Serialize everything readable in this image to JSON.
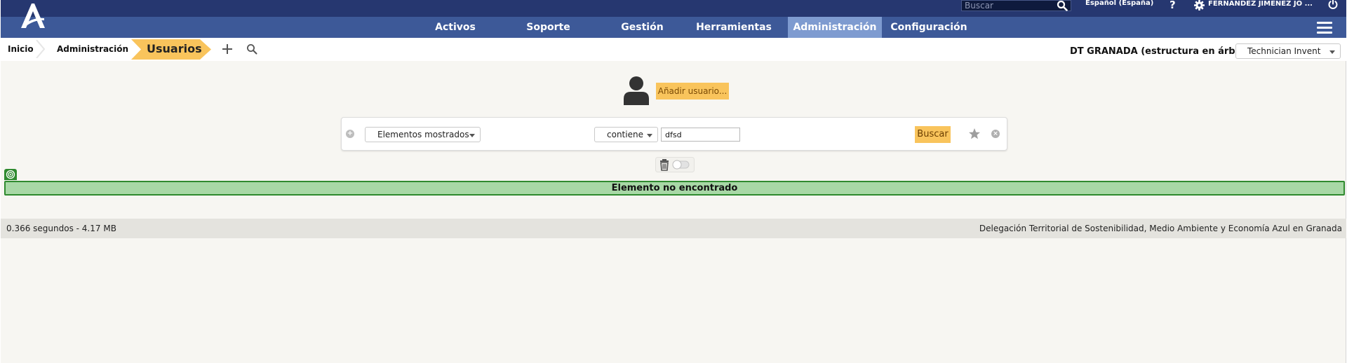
{
  "app": {
    "logo": "A"
  },
  "topbar": {
    "search_placeholder": "Buscar",
    "language": "Español (España)",
    "help": "?",
    "user": "FERNANDEZ JIMENEZ JO ..."
  },
  "nav": {
    "items": [
      {
        "label": "Activos"
      },
      {
        "label": "Soporte"
      },
      {
        "label": "Gestión"
      },
      {
        "label": "Herramientas"
      },
      {
        "label": "Administración",
        "active": true
      },
      {
        "label": "Configuración"
      }
    ]
  },
  "breadcrumb": {
    "items": [
      "Inicio",
      "Administración"
    ],
    "current": "Usuarios"
  },
  "context": {
    "tree_label": "DT GRANADA (estructura en árbol)",
    "profile": "Technician Invent"
  },
  "actions": {
    "add_user": "Añadir usuario..."
  },
  "filter": {
    "field": "Elementos mostrados",
    "operator": "contiene",
    "value": "dfsd",
    "search_label": "Buscar"
  },
  "message": {
    "text": "Elemento no encontrado"
  },
  "footer": {
    "stats": "0.366 segundos - 4.17 MB",
    "organization": "Delegación Territorial de Sostenibilidad, Medio Ambiente y Economía Azul en Granada"
  },
  "colors": {
    "topbar": "#263770",
    "navbar": "#3d5998",
    "nav_active": "#7e9bd0",
    "accent": "#f9c45c",
    "notice_bg": "#a8d8a6",
    "notice_border": "#2f8a2f"
  }
}
